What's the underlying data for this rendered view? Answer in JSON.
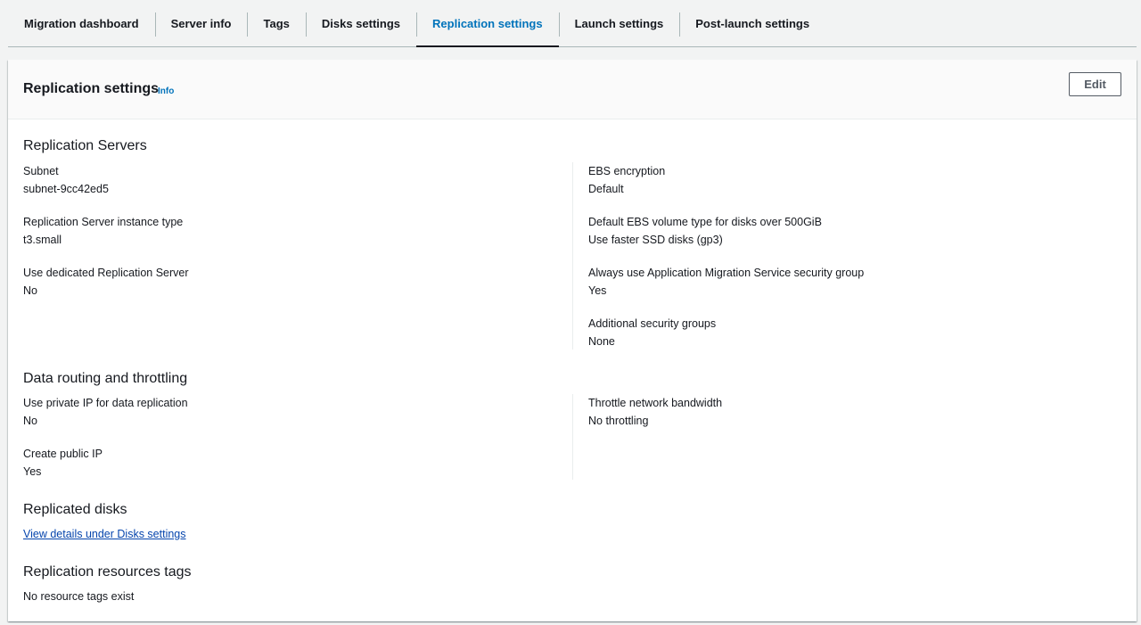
{
  "tabs": [
    {
      "label": "Migration dashboard"
    },
    {
      "label": "Server info"
    },
    {
      "label": "Tags"
    },
    {
      "label": "Disks settings"
    },
    {
      "label": "Replication settings",
      "active": true
    },
    {
      "label": "Launch settings"
    },
    {
      "label": "Post-launch settings"
    }
  ],
  "panel": {
    "title": "Replication settings",
    "info_label": "Info",
    "edit_label": "Edit"
  },
  "replication_servers": {
    "title": "Replication Servers",
    "left": [
      {
        "label": "Subnet",
        "value": "subnet-9cc42ed5"
      },
      {
        "label": "Replication Server instance type",
        "value": "t3.small"
      },
      {
        "label": "Use dedicated Replication Server",
        "value": "No"
      }
    ],
    "right": [
      {
        "label": "EBS encryption",
        "value": "Default"
      },
      {
        "label": "Default EBS volume type for disks over 500GiB",
        "value": "Use faster SSD disks (gp3)"
      },
      {
        "label": "Always use Application Migration Service security group",
        "value": "Yes"
      },
      {
        "label": "Additional security groups",
        "value": "None"
      }
    ]
  },
  "data_routing": {
    "title": "Data routing and throttling",
    "left": [
      {
        "label": "Use private IP for data replication",
        "value": "No"
      },
      {
        "label": "Create public IP",
        "value": "Yes"
      }
    ],
    "right": [
      {
        "label": "Throttle network bandwidth",
        "value": "No throttling"
      }
    ]
  },
  "replicated_disks": {
    "title": "Replicated disks",
    "link_label": "View details under Disks settings"
  },
  "resource_tags": {
    "title": "Replication resources tags",
    "empty_text": "No resource tags exist"
  }
}
